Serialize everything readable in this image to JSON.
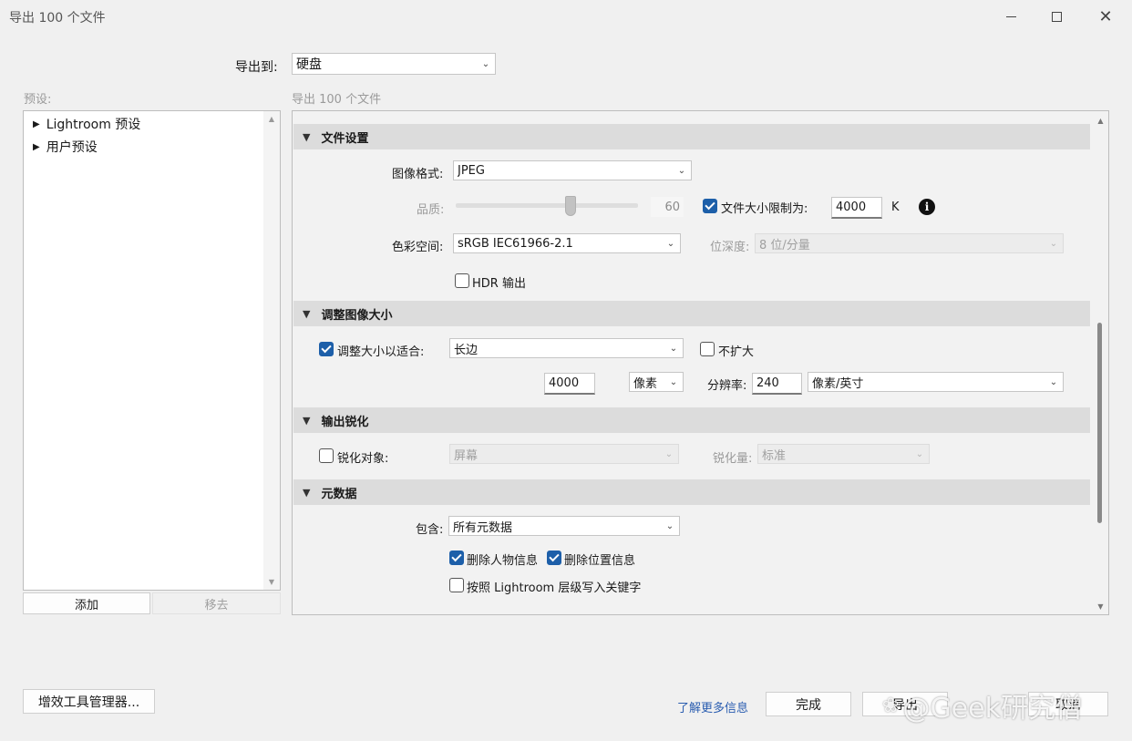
{
  "window": {
    "title": "导出 100 个文件"
  },
  "export_to": {
    "label": "导出到:",
    "value": "硬盘"
  },
  "presets": {
    "label": "预设:",
    "items": [
      {
        "arrow": "▶",
        "label": "Lightroom 预设"
      },
      {
        "arrow": "▶",
        "label": "用户预设"
      }
    ],
    "add_label": "添加",
    "remove_label": "移去"
  },
  "panel_caption": "导出 100 个文件",
  "file_settings": {
    "header": "文件设置",
    "format_label": "图像格式:",
    "format_value": "JPEG",
    "quality_label": "品质:",
    "quality_value": "60",
    "quality_fraction": 0.6,
    "limit_label": "文件大小限制为:",
    "limit_checked": true,
    "limit_value": "4000",
    "limit_unit": "K",
    "colorspace_label": "色彩空间:",
    "colorspace_value": "sRGB IEC61966-2.1",
    "bitdepth_label": "位深度:",
    "bitdepth_value": "8 位/分量",
    "hdr_label": "HDR 输出",
    "hdr_checked": false
  },
  "resize": {
    "header": "调整图像大小",
    "fit_label": "调整大小以适合:",
    "fit_checked": true,
    "fit_value": "长边",
    "no_enlarge_label": "不扩大",
    "no_enlarge_checked": false,
    "size_value": "4000",
    "size_unit": "像素",
    "res_label": "分辨率:",
    "res_value": "240",
    "res_unit": "像素/英寸"
  },
  "sharpen": {
    "header": "输出锐化",
    "target_label": "锐化对象:",
    "target_checked": false,
    "target_value": "屏幕",
    "amount_label": "锐化量:",
    "amount_value": "标准"
  },
  "metadata": {
    "header": "元数据",
    "include_label": "包含:",
    "include_value": "所有元数据",
    "remove_person_label": "删除人物信息",
    "remove_person_checked": true,
    "remove_location_label": "删除位置信息",
    "remove_location_checked": true,
    "hierarchy_label": "按照 Lightroom 层级写入关键字",
    "hierarchy_checked": false
  },
  "footer": {
    "plugin_manager": "增效工具管理器...",
    "learn_more": "了解更多信息",
    "done": "完成",
    "export": "导出",
    "cancel": "取消",
    "watermark": "@Geek研究僧"
  },
  "colors": {
    "accent": "#1d5fa9",
    "link": "#2a5db0",
    "section_bg": "#dcdcdc"
  }
}
